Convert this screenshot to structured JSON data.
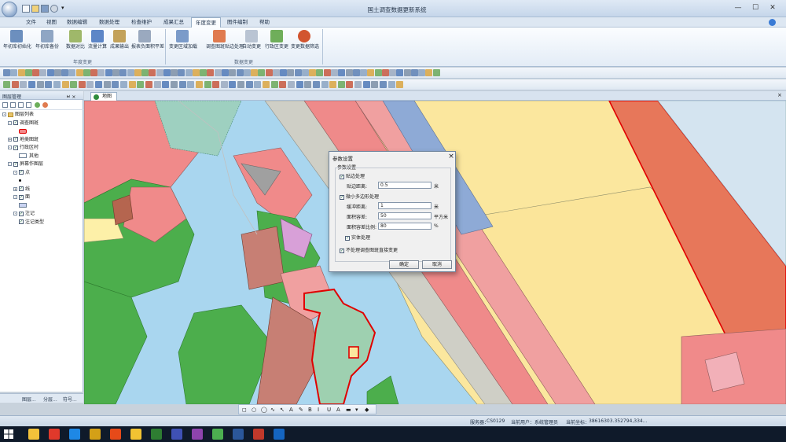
{
  "window": {
    "title": "国土调查数据更新系统",
    "controls": [
      "—",
      "☐",
      "✕"
    ]
  },
  "menu": {
    "tabs": [
      "文件",
      "视图",
      "数据编辑",
      "数据处理",
      "检查维护",
      "成果汇总",
      "年度变更",
      "图件编制",
      "帮助"
    ],
    "active_index": 6
  },
  "ribbon": {
    "group1": {
      "label": "年度变更",
      "buttons": [
        "年初库初始化",
        "年初库备份",
        "数据对比",
        "流量计算",
        "成果输出",
        "报表负面积平差"
      ]
    },
    "group2": {
      "label": "数据变更",
      "buttons": [
        "变更区域加载",
        "调查图斑贴边处理",
        "自动变更",
        "行政区变更",
        "变更数据筛选"
      ]
    }
  },
  "layer_panel": {
    "title": "图层管理",
    "pin": "ㅂ ×",
    "tree": [
      {
        "indent": 0,
        "expander": "-",
        "check": false,
        "folder": true,
        "label": "图层列表"
      },
      {
        "indent": 1,
        "expander": "-",
        "check": true,
        "label": "调查图斑"
      },
      {
        "indent": 3,
        "legend": "#f28a8a",
        "label": ""
      },
      {
        "indent": 1,
        "expander": "+",
        "check": true,
        "label": "地类图斑"
      },
      {
        "indent": 1,
        "expander": "-",
        "check": true,
        "label": "行政区村"
      },
      {
        "indent": 3,
        "legend": "#ffffff",
        "label": "其他"
      },
      {
        "indent": 1,
        "expander": "-",
        "check": true,
        "label": "屏幕作图层"
      },
      {
        "indent": 2,
        "expander": "-",
        "check": true,
        "label": "点"
      },
      {
        "indent": 3,
        "legend": "dot",
        "label": ""
      },
      {
        "indent": 2,
        "expander": "+",
        "check": true,
        "label": "线"
      },
      {
        "indent": 2,
        "expander": "-",
        "check": true,
        "label": "面"
      },
      {
        "indent": 3,
        "legend": "#c9d3f2",
        "label": ""
      },
      {
        "indent": 2,
        "expander": "-",
        "check": true,
        "label": "注记"
      },
      {
        "indent": 3,
        "expander": "",
        "check": true,
        "label": "注记类型"
      }
    ],
    "bottom_tabs": [
      "图层...",
      "分层...",
      "符号..."
    ]
  },
  "document_tab": {
    "label": "地图"
  },
  "dialog": {
    "title": "参数设置",
    "close": "×",
    "section": "参数设置",
    "edge_check": {
      "label": "贴边处理",
      "checked": true
    },
    "edge_dist": {
      "label": "贴边距离:",
      "value": "0.5",
      "unit": "米"
    },
    "small_check": {
      "label": "微小多边形处理",
      "checked": true
    },
    "buffer": {
      "label": "缓冲距离:",
      "value": "1",
      "unit": "米"
    },
    "area": {
      "label": "面积容差:",
      "value": "50",
      "unit": "平方米"
    },
    "area_ratio": {
      "label": "面积容差比例:",
      "value": "80",
      "unit": "%"
    },
    "real_check": {
      "label": "实体处理",
      "checked": true
    },
    "direct_check": {
      "label": "不处理调查图斑直接变更",
      "checked": true
    },
    "ok": "确定",
    "cancel": "取消"
  },
  "statusbar": {
    "server": "服务器：",
    "server_value": "CS0129",
    "user": "当前用户：",
    "user_value": "系统管理员",
    "coord_label": "当前坐标：",
    "coord_value": "38616303.352794,334..."
  },
  "taskbar": {
    "apps": [
      "explorer-flag",
      "arrow-app",
      "ie",
      "gem",
      "chrome",
      "files",
      "notes",
      "photos",
      "gallery",
      "wechat",
      "word",
      "shield",
      "gis"
    ]
  },
  "colors": {
    "red_polygon": "#f08080",
    "yellow": "#fbe79e",
    "green": "#4caf50",
    "water": "#a9d6ef",
    "boundary": "#e00000",
    "road": "#c9c9c1"
  }
}
